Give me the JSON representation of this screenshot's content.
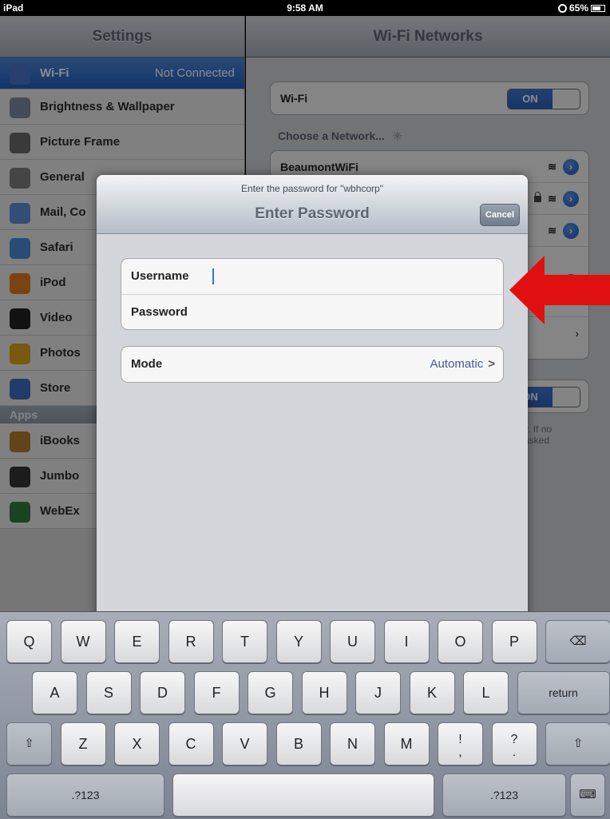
{
  "status_bar": {
    "device": "iPad",
    "time": "9:58 AM",
    "battery": "65%"
  },
  "settings": {
    "title": "Settings",
    "items": [
      {
        "label": "Wi-Fi",
        "value": "Not Connected",
        "icon": "wifi-icon",
        "color": "#4a76c8"
      },
      {
        "label": "Brightness & Wallpaper",
        "icon": "brightness-icon",
        "color": "#7a8a9e"
      },
      {
        "label": "Picture Frame",
        "icon": "picture-frame-icon",
        "color": "#6a6a6a"
      },
      {
        "label": "General",
        "icon": "gear-icon",
        "color": "#7e7e7e"
      },
      {
        "label": "Mail, Co",
        "icon": "mail-icon",
        "color": "#5b8ed8"
      },
      {
        "label": "Safari",
        "icon": "safari-icon",
        "color": "#4a8ad8"
      },
      {
        "label": "iPod",
        "icon": "ipod-icon",
        "color": "#e07a1f"
      },
      {
        "label": "Video",
        "icon": "video-icon",
        "color": "#222222"
      },
      {
        "label": "Photos",
        "icon": "photos-icon",
        "color": "#d9a21e"
      },
      {
        "label": "Store",
        "icon": "store-icon",
        "color": "#3b6ec2"
      }
    ],
    "apps_header": "Apps",
    "apps": [
      {
        "label": "iBooks",
        "icon": "ibooks-icon",
        "color": "#b57a2c"
      },
      {
        "label": "Jumbo",
        "icon": "jumbo-icon",
        "color": "#333333"
      },
      {
        "label": "WebEx",
        "icon": "webex-icon",
        "color": "#2f7a3c"
      }
    ]
  },
  "wifi_pane": {
    "title": "Wi-Fi Networks",
    "wifi_label": "Wi-Fi",
    "wifi_toggle": "ON",
    "choose_label": "Choose a Network...",
    "networks": [
      {
        "name": "BeaumontWiFi"
      }
    ],
    "ask_toggle": "ON",
    "hint_partial": "y. If no\nasked"
  },
  "dialog": {
    "prompt": "Enter the password for \"wbhcorp\"",
    "title": "Enter Password",
    "cancel_label": "Cancel",
    "username_label": "Username",
    "password_label": "Password",
    "mode_label": "Mode",
    "mode_value": "Automatic",
    "chevron": ">"
  },
  "annotation": {
    "arrow_color": "#e01010"
  },
  "keyboard": {
    "row1": [
      "Q",
      "W",
      "E",
      "R",
      "T",
      "Y",
      "U",
      "I",
      "O",
      "P"
    ],
    "row2": [
      "A",
      "S",
      "D",
      "F",
      "G",
      "H",
      "J",
      "K",
      "L"
    ],
    "row3": [
      "Z",
      "X",
      "C",
      "V",
      "B",
      "N",
      "M"
    ],
    "return_label": "return",
    "numbers_label": ".?123",
    "backspace_icon": "backspace-icon",
    "shift_icon": "shift-icon",
    "hide_keyboard_icon": "keyboard-hide-icon",
    "exclaim_top": "!",
    "exclaim_bottom": ",",
    "question_top": "?",
    "question_bottom": "."
  }
}
